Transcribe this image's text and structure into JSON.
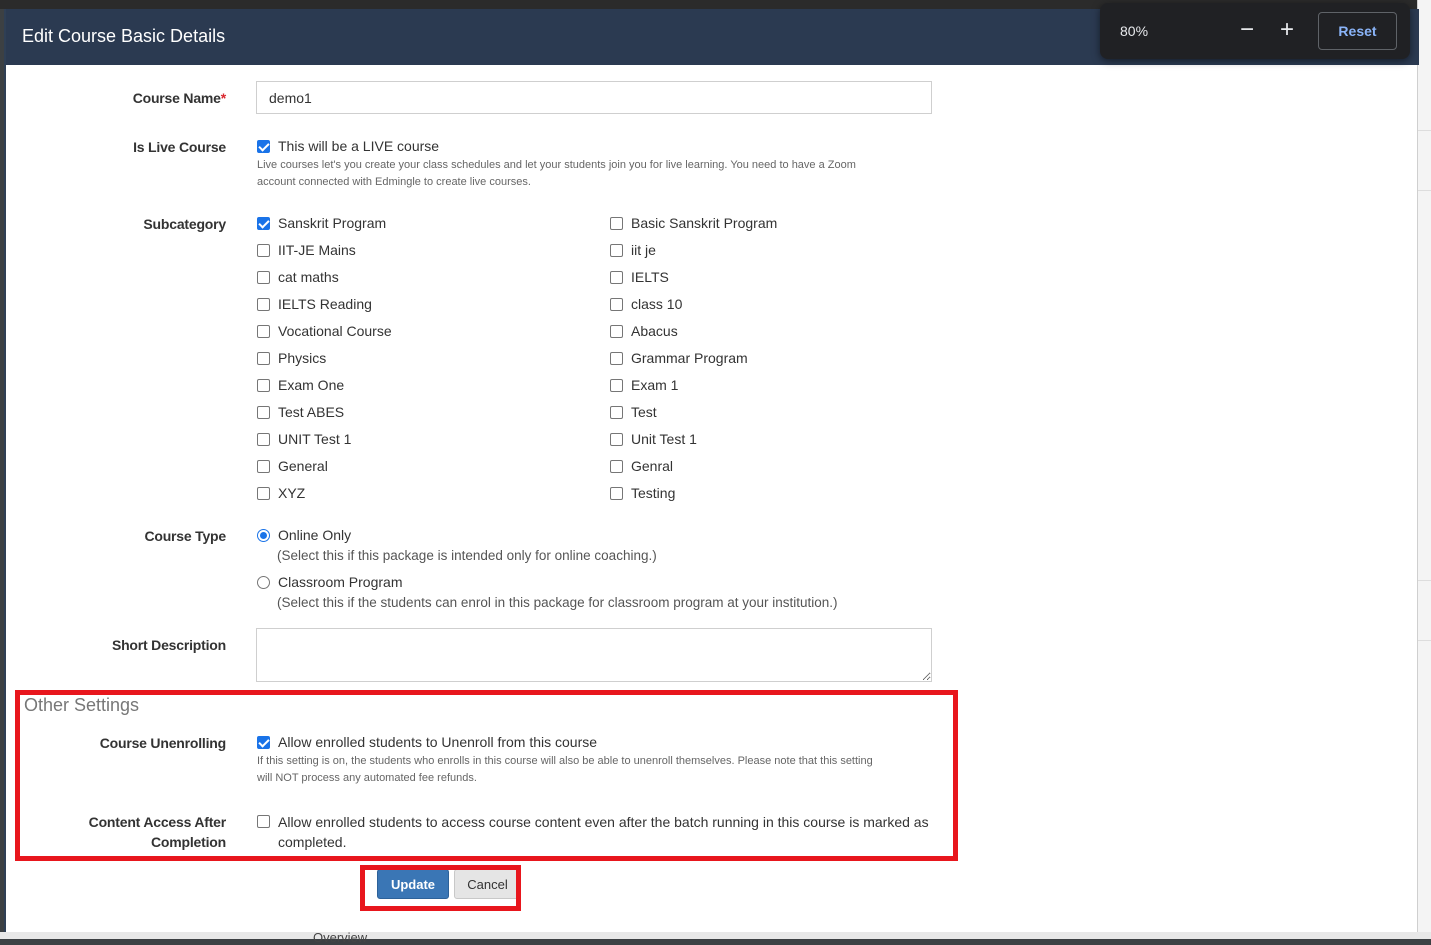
{
  "modal": {
    "title": "Edit Course Basic Details"
  },
  "zoom": {
    "level": "80%",
    "minus": "−",
    "plus": "+",
    "reset_label": "Reset"
  },
  "course_name": {
    "label": "Course Name",
    "required_mark": "*",
    "value": "demo1"
  },
  "live_course": {
    "label": "Is Live Course",
    "checkbox_label": "This will be a LIVE course",
    "checked": true,
    "help_line1": "Live courses let's you create your class schedules and let your students join you for live learning. You need to have a Zoom",
    "help_line2": "account connected with Edmingle to create live courses."
  },
  "subcategory": {
    "label": "Subcategory",
    "left": [
      {
        "label": "Sanskrit Program",
        "checked": true
      },
      {
        "label": "IIT-JE Mains",
        "checked": false
      },
      {
        "label": "cat maths",
        "checked": false
      },
      {
        "label": "IELTS Reading",
        "checked": false
      },
      {
        "label": "Vocational Course",
        "checked": false
      },
      {
        "label": "Physics",
        "checked": false
      },
      {
        "label": "Exam One",
        "checked": false
      },
      {
        "label": "Test ABES",
        "checked": false
      },
      {
        "label": "UNIT Test 1",
        "checked": false
      },
      {
        "label": "General",
        "checked": false
      },
      {
        "label": "XYZ",
        "checked": false
      }
    ],
    "right": [
      {
        "label": "Basic Sanskrit Program",
        "checked": false
      },
      {
        "label": "iit je",
        "checked": false
      },
      {
        "label": "IELTS",
        "checked": false
      },
      {
        "label": "class 10",
        "checked": false
      },
      {
        "label": "Abacus",
        "checked": false
      },
      {
        "label": "Grammar Program",
        "checked": false
      },
      {
        "label": "Exam 1",
        "checked": false
      },
      {
        "label": "Test",
        "checked": false
      },
      {
        "label": "Unit Test 1",
        "checked": false
      },
      {
        "label": "Genral",
        "checked": false
      },
      {
        "label": "Testing",
        "checked": false
      }
    ]
  },
  "course_type": {
    "label": "Course Type",
    "online_label": "Online Only",
    "online_help": "(Select this if this package is intended only for online coaching.)",
    "online_selected": true,
    "classroom_label": "Classroom Program",
    "classroom_help": "(Select this if the students can enrol in this package for classroom program at your institution.)",
    "classroom_selected": false
  },
  "short_description": {
    "label": "Short Description",
    "value": ""
  },
  "other_settings": {
    "title": "Other Settings",
    "unenrolling_label": "Course Unenrolling",
    "unenrolling_checkbox": "Allow enrolled students to Unenroll from this course",
    "unenrolling_checked": true,
    "unenrolling_help1": "If this setting is on, the students who enrolls in this course will also be able to unenroll themselves. Please note that this setting",
    "unenrolling_help2": "will NOT process any automated fee refunds.",
    "access_label1": "Content Access After",
    "access_label2": "Completion",
    "access_checkbox1": "Allow enrolled students to access course content even after the batch running in this course is marked as",
    "access_checkbox2": "completed.",
    "access_checked": false
  },
  "actions": {
    "update_label": "Update",
    "cancel_label": "Cancel"
  },
  "background": {
    "overview_label": "Overview"
  },
  "colors": {
    "header": "#2b3a51",
    "accent": "#1a73e8",
    "highlight": "#e8161d",
    "update_button": "#3a76b5"
  }
}
